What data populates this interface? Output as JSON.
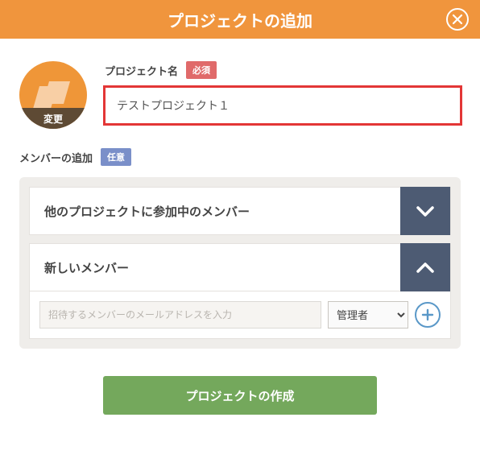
{
  "header": {
    "title": "プロジェクトの追加"
  },
  "avatar": {
    "change_label": "変更"
  },
  "project_name": {
    "label": "プロジェクト名",
    "badge": "必須",
    "value": "テストプロジェクト１"
  },
  "members": {
    "label": "メンバーの追加",
    "badge": "任意"
  },
  "accordion": {
    "other": "他のプロジェクトに参加中のメンバー",
    "new": "新しいメンバー"
  },
  "invite": {
    "placeholder": "招待するメンバーのメールアドレスを入力",
    "role": "管理者"
  },
  "submit": {
    "label": "プロジェクトの作成"
  }
}
